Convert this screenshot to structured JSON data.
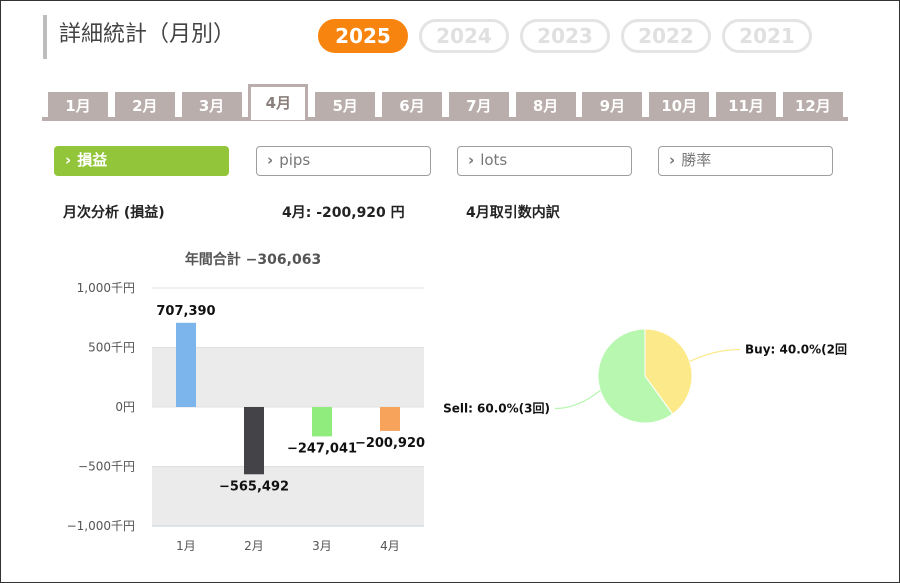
{
  "header": {
    "title": "詳細統計（月別）"
  },
  "years": [
    "2025",
    "2024",
    "2023",
    "2022",
    "2021"
  ],
  "active_year_index": 0,
  "months": [
    "1月",
    "2月",
    "3月",
    "4月",
    "5月",
    "6月",
    "7月",
    "8月",
    "9月",
    "10月",
    "11月",
    "12月"
  ],
  "active_month_index": 3,
  "metric_buttons": [
    {
      "label": "損益",
      "chevron": "chevron-right-icon"
    },
    {
      "label": "pips",
      "chevron": "chevron-right-icon"
    },
    {
      "label": "lots",
      "chevron": "chevron-right-icon"
    },
    {
      "label": "勝率",
      "chevron": "chevron-right-icon"
    }
  ],
  "active_metric_index": 0,
  "labels": {
    "monthly_analysis": "月次分析 (損益)",
    "month_total": "4月:  -200,920 円",
    "breakdown_title": "4月取引数内訳"
  },
  "colors": {
    "accent_orange": "#f7840e",
    "metric_active": "#92c53a",
    "tab_bg": "#b9aeab"
  },
  "chart_data": [
    {
      "type": "bar",
      "subtitle": "年間合計 −306,063",
      "categories": [
        "1月",
        "2月",
        "3月",
        "4月"
      ],
      "values": [
        707390,
        -565492,
        -247041,
        -200920
      ],
      "value_labels": [
        "707,390",
        "−565,492",
        "−247,041",
        "−200,920"
      ],
      "bar_colors": [
        "#7cb5ec",
        "#434348",
        "#90ed7d",
        "#f7a35c"
      ],
      "ylim": [
        -1000000,
        1000000
      ],
      "yticks": [
        1000000,
        500000,
        0,
        -500000,
        -1000000
      ],
      "ytick_labels": [
        "1,000千円",
        "500千円",
        "0円",
        "−500千円",
        "−1,000千円"
      ],
      "grid": "alternating bands"
    },
    {
      "type": "pie",
      "slices": [
        {
          "name": "Buy",
          "value": 40.0,
          "label": "Buy: 40.0%(2回",
          "color": "#fbe98a"
        },
        {
          "name": "Sell",
          "value": 60.0,
          "label": "Sell: 60.0%(3回)",
          "color": "#b7f7b0"
        }
      ]
    }
  ]
}
